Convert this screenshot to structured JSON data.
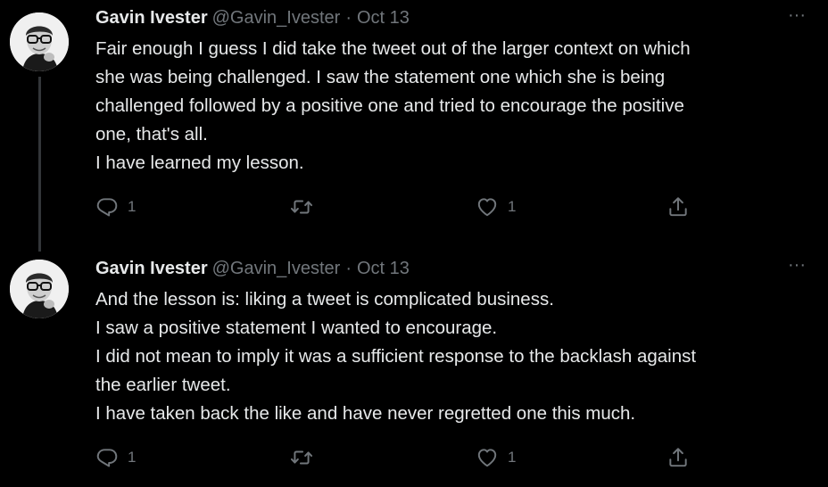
{
  "tweets": [
    {
      "display_name": "Gavin Ivester",
      "handle": "@Gavin_Ivester",
      "separator": "·",
      "date": "Oct 13",
      "more_label": "···",
      "lines": [
        "Fair enough I guess I did take the tweet out of the larger context on which",
        "she was being challenged. I saw the statement one which she is being",
        "challenged followed by a positive one and tried to encourage the positive",
        "one, that's all.",
        "I have learned my lesson."
      ],
      "reply_count": "1",
      "like_count": "1"
    },
    {
      "display_name": "Gavin Ivester",
      "handle": "@Gavin_Ivester",
      "separator": "·",
      "date": "Oct 13",
      "more_label": "···",
      "lines": [
        "And the lesson is: liking a tweet is complicated business.",
        "I saw a positive statement I wanted to encourage.",
        "I did not mean to imply it was a sufficient response to the backlash against",
        "the earlier tweet.",
        "I have taken back the like and have never regretted one this much."
      ],
      "reply_count": "1",
      "like_count": "1"
    }
  ],
  "icons": {
    "reply": "reply-icon",
    "retweet": "retweet-icon",
    "like": "heart-icon",
    "share": "share-icon",
    "more": "more-icon"
  },
  "colors": {
    "background": "#000000",
    "primary_text": "#e7e9ea",
    "secondary_text": "#71767b",
    "thread_line": "#333639"
  }
}
